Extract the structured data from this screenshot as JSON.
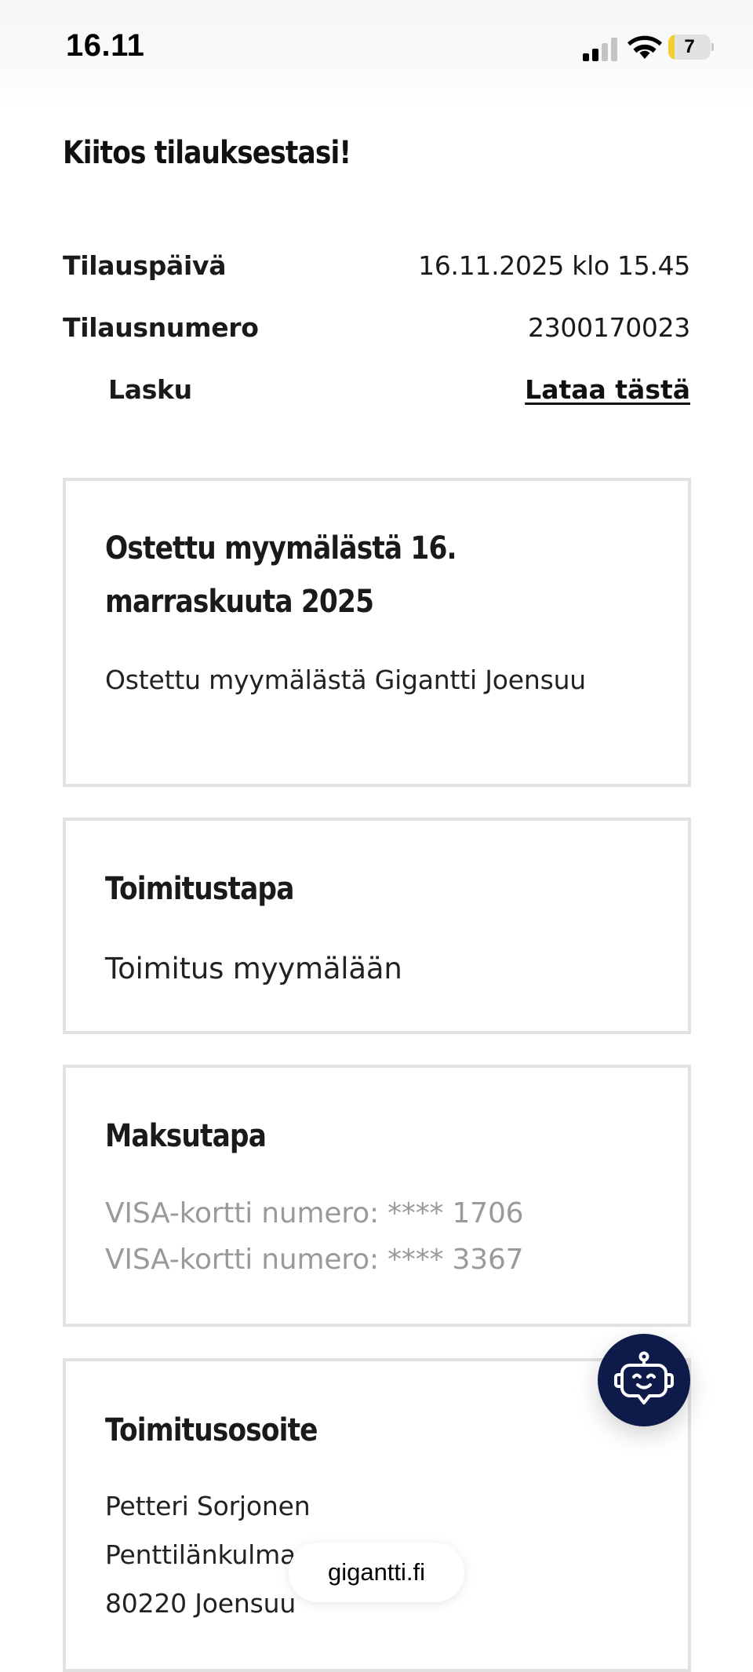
{
  "status_bar": {
    "time": "16.11",
    "signal_bars_active": 2,
    "signal_bars_total": 4,
    "battery_level": "7",
    "battery_fraction": 0.07,
    "battery_color": "#f1cf33"
  },
  "page": {
    "title": "Kiitos tilauksestasi!"
  },
  "order_info": {
    "date_label": "Tilauspäivä",
    "date_value": "16.11.2025 klo 15.45",
    "number_label": "Tilausnumero",
    "number_value": "2300170023",
    "invoice_label": "Lasku",
    "invoice_link": "Lataa tästä"
  },
  "cards": {
    "purchase": {
      "title": "Ostettu myymälästä 16. marraskuuta 2025",
      "text": "Ostettu myymälästä Gigantti Joensuu"
    },
    "delivery_method": {
      "title": "Toimitustapa",
      "text": "Toimitus myymälään"
    },
    "payment_method": {
      "title": "Maksutapa",
      "lines": [
        "VISA-kortti numero: **** 1706",
        "VISA-kortti numero: **** 3367"
      ]
    },
    "delivery_address": {
      "title": "Toimitusosoite",
      "lines": [
        "Petteri Sorjonen",
        "Penttilänkulma",
        "80220 Joensuu"
      ]
    }
  },
  "chat_bot": {
    "icon": "robot-icon",
    "color": "#0d1a4a"
  },
  "browser": {
    "url": "gigantti.fi"
  }
}
